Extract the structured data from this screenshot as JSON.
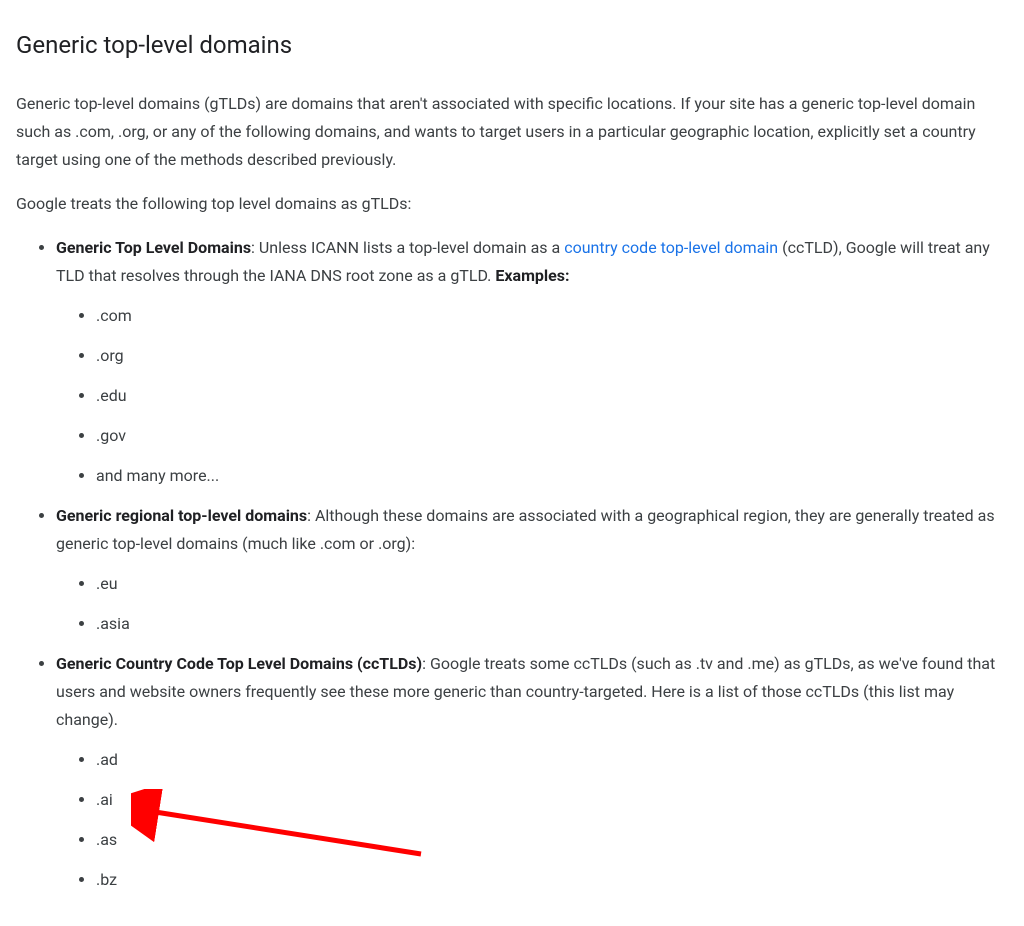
{
  "heading": "Generic top-level domains",
  "intro_paragraph": "Generic top-level domains (gTLDs) are domains that aren't associated with specific locations. If your site has a generic top-level domain such as .com, .org, or any of the following domains, and wants to target users in a particular geographic location, explicitly set a country target using one of the methods described previously.",
  "lead_in": "Google treats the following top level domains as gTLDs:",
  "sections": {
    "gtld": {
      "title": "Generic Top Level Domains",
      "desc_before_link": ": Unless ICANN lists a top-level domain as a ",
      "link_text": "country code top-level domain",
      "desc_after_link": " (ccTLD), Google will treat any TLD that resolves through the IANA DNS root zone as a gTLD. ",
      "examples_label": "Examples:",
      "items": [
        ".com",
        ".org",
        ".edu",
        ".gov",
        "and many more..."
      ]
    },
    "regional": {
      "title": "Generic regional top-level domains",
      "desc": ": Although these domains are associated with a geographical region, they are generally treated as generic top-level domains (much like .com or .org):",
      "items": [
        ".eu",
        ".asia"
      ]
    },
    "cctld": {
      "title": "Generic Country Code Top Level Domains (ccTLDs)",
      "desc": ": Google treats some ccTLDs (such as .tv and .me) as gTLDs, as we've found that users and website owners frequently see these more generic than country-targeted. Here is a list of those ccTLDs (this list may change).",
      "items": [
        ".ad",
        ".ai",
        ".as",
        ".bz"
      ]
    }
  },
  "annotation": {
    "color": "#ff0000"
  }
}
